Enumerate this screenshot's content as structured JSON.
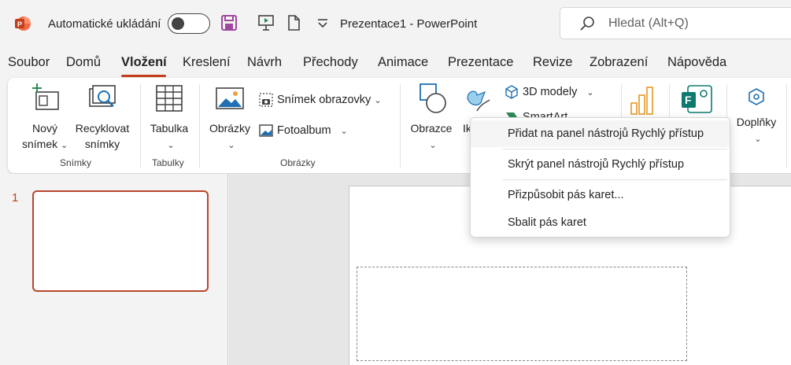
{
  "title_bar": {
    "autosave_label": "Automatické ukládání",
    "document_title": "Prezentace1  -  PowerPoint",
    "search_placeholder": "Hledat (Alt+Q)"
  },
  "tabs": [
    "Soubor",
    "Domů",
    "Vložení",
    "Kreslení",
    "Návrh",
    "Přechody",
    "Animace",
    "Prezentace",
    "Revize",
    "Zobrazení",
    "Nápověda"
  ],
  "active_tab": "Vložení",
  "ribbon": {
    "new_slide": [
      "Nový",
      "snímek"
    ],
    "recycle_slides": [
      "Recyklovat",
      "snímky"
    ],
    "group_slides": "Snímky",
    "table": "Tabulka",
    "group_tables": "Tabulky",
    "pictures": "Obrázky",
    "screenshot": "Snímek obrazovky",
    "photo_album": "Fotoalbum",
    "group_images": "Obrázky",
    "shapes": "Obrazce",
    "icons_partial": "Ik",
    "models_3d": "3D modely",
    "smartart_partial": "SmartArt",
    "addins": "Doplňky"
  },
  "context_menu": {
    "items": [
      "Přidat na panel nástrojů Rychlý přístup",
      "Skrýt panel nástrojů Rychlý přístup",
      "Přizpůsobit pás karet...",
      "Sbalit pás karet"
    ]
  },
  "slides_pane": {
    "slide_number": "1"
  },
  "colors": {
    "accent": "#c43e1c",
    "thumb_border": "#b7472a"
  }
}
